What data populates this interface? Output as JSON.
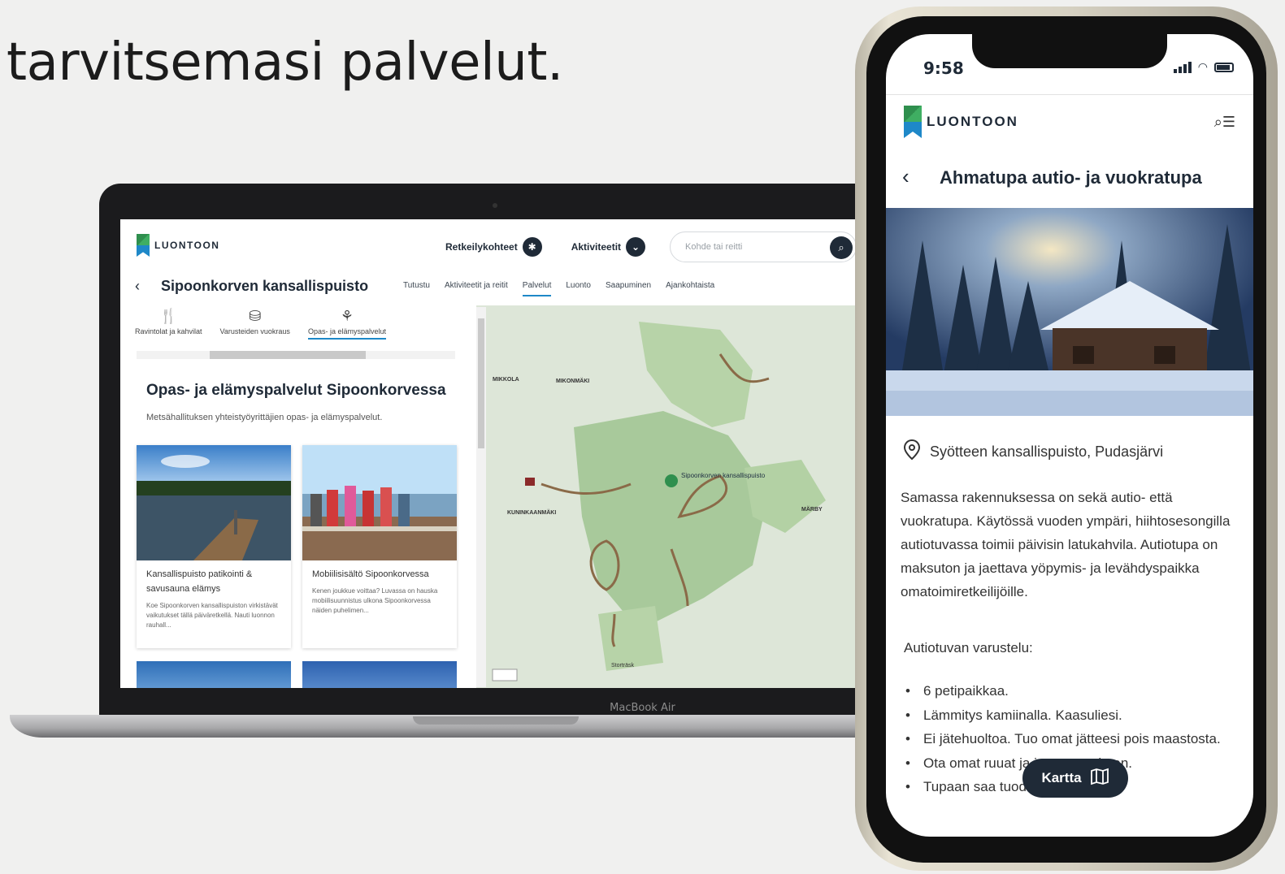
{
  "headline": "tarvitsemasi palvelut.",
  "laptop_label": "MacBook Air",
  "desktop": {
    "logo_text": "LUONTOON",
    "nav": [
      {
        "label": "Retkeilykohteet",
        "icon": "compass-icon"
      },
      {
        "label": "Aktiviteetit",
        "icon": "chevron-down-icon"
      }
    ],
    "search_placeholder": "Kohde tai reitti",
    "park_title": "Sipoonkorven kansallispuisto",
    "tabs": [
      "Tutustu",
      "Aktiviteetit ja reitit",
      "Palvelut",
      "Luonto",
      "Saapuminen",
      "Ajankohtaista"
    ],
    "active_tab": "Palvelut",
    "categories": [
      {
        "label": "Ravintolat ja kahvilat",
        "icon": "cutlery-icon"
      },
      {
        "label": "Varusteiden vuokraus",
        "icon": "rental-icon"
      },
      {
        "label": "Opas- ja elämyspalvelut",
        "icon": "guide-icon"
      }
    ],
    "section_title": "Opas- ja elämyspalvelut Sipoonkorvessa",
    "section_desc": "Metsähallituksen yhteistyöyrittäjien opas- ja elämyspalvelut.",
    "cards": [
      {
        "title": "Kansallispuisto patikointi & savusauna elämys",
        "text": "Koe Sipoonkorven kansallispuiston virkistävät vaikutukset tällä päiväretkellä. Nauti luonnon rauhall..."
      },
      {
        "title": "Mobiilisisältö Sipoonkorvessa",
        "text": "Kenen joukkue voittaa? Luvassa on hauska mobiilisuunnistus ulkona Sipoonkorvessa näiden puhelimen..."
      }
    ],
    "map_labels": [
      "MIKKOLA",
      "MIKONMÄKI",
      "Sipoonkorven kansallispuisto",
      "KUNINKAANMÄKI",
      "MÄRBY",
      "Storträsk"
    ]
  },
  "phone": {
    "time": "9:58",
    "logo_text": "LUONTOON",
    "title": "Ahmatupa autio- ja vuokratupa",
    "location": "Syötteen kansallispuisto, Pudasjärvi",
    "body": "Samassa rakennuksessa on sekä autio- että vuokratupa. Käytössä vuoden ympäri, hiihtosesongilla autiotuvassa toimii päivisin latukahvila. Autiotupa on maksuton ja jaettava yöpymis- ja levähdyspaikka omatoimiretkeilijöille.",
    "equipment_heading": "Autiotuvan varustelu:",
    "equipment": [
      "6 petipaikkaa.",
      "Lämmitys kamiinalla. Kaasuliesi.",
      "Ei jätehuoltoa. Tuo omat jätteesi pois maastosta.",
      "Ota omat ruuat ja juomat mukaan.",
      "Tupaan saa tuoda lemmikkejä."
    ],
    "map_button": "Kartta"
  }
}
